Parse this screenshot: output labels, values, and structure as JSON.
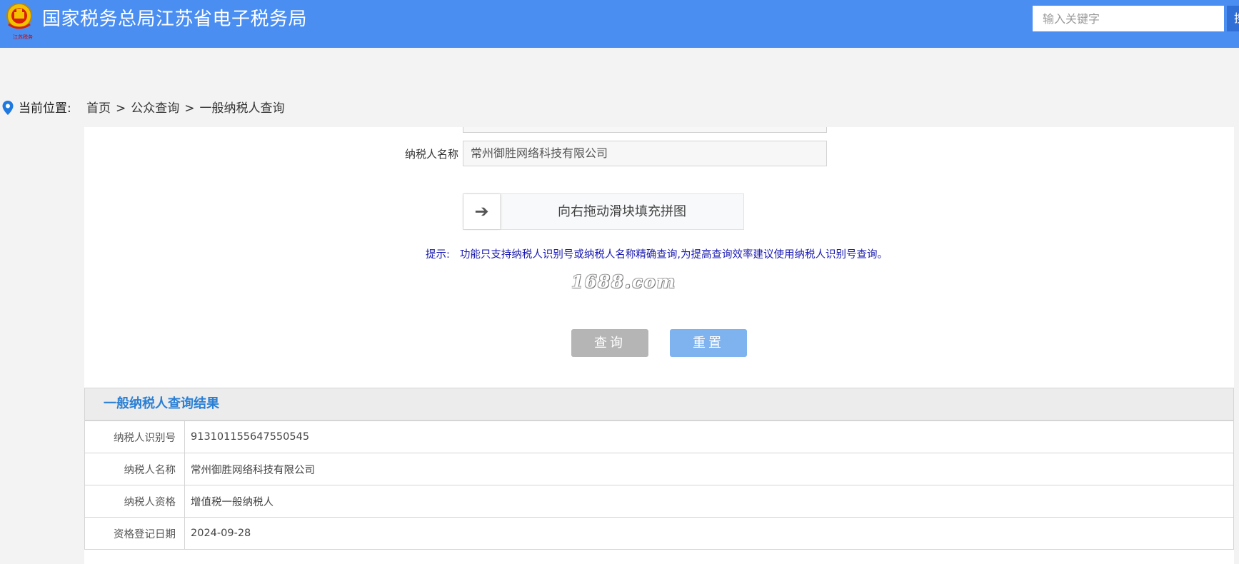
{
  "header": {
    "logo_text": "江苏税务",
    "title": "国家税务总局江苏省电子税务局",
    "search_placeholder": "输入关键字",
    "search_button_label": "搜"
  },
  "breadcrumb": {
    "label": "当前位置:",
    "items": [
      "首页",
      "公众查询",
      "一般纳税人查询"
    ],
    "separator": ">"
  },
  "form": {
    "taxpayer_name_label": "纳税人名称",
    "taxpayer_name_value": "常州御胜网络科技有限公司",
    "slider_text": "向右拖动滑块填充拼图",
    "slider_icon": "arrow-right-icon",
    "tip_label": "提示:",
    "tip_text": "功能只支持纳税人识别号或纳税人名称精确查询,为提高查询效率建议使用纳税人识别号查询。",
    "watermark": "1688.com",
    "query_button": "查询",
    "reset_button": "重置"
  },
  "result": {
    "title": "一般纳税人查询结果",
    "rows": [
      {
        "label": "纳税人识别号",
        "value": "913101155647550545"
      },
      {
        "label": "纳税人名称",
        "value": "常州御胜网络科技有限公司"
      },
      {
        "label": "纳税人资格",
        "value": "增值税一般纳税人"
      },
      {
        "label": "资格登记日期",
        "value": "2024-09-28"
      }
    ]
  },
  "colors": {
    "header_bg": "#4a8ef2",
    "tip_text": "#1a1ab0",
    "result_title": "#2a7fd4",
    "query_button": "#b5b5b5",
    "reset_button": "#7fb3ef"
  }
}
